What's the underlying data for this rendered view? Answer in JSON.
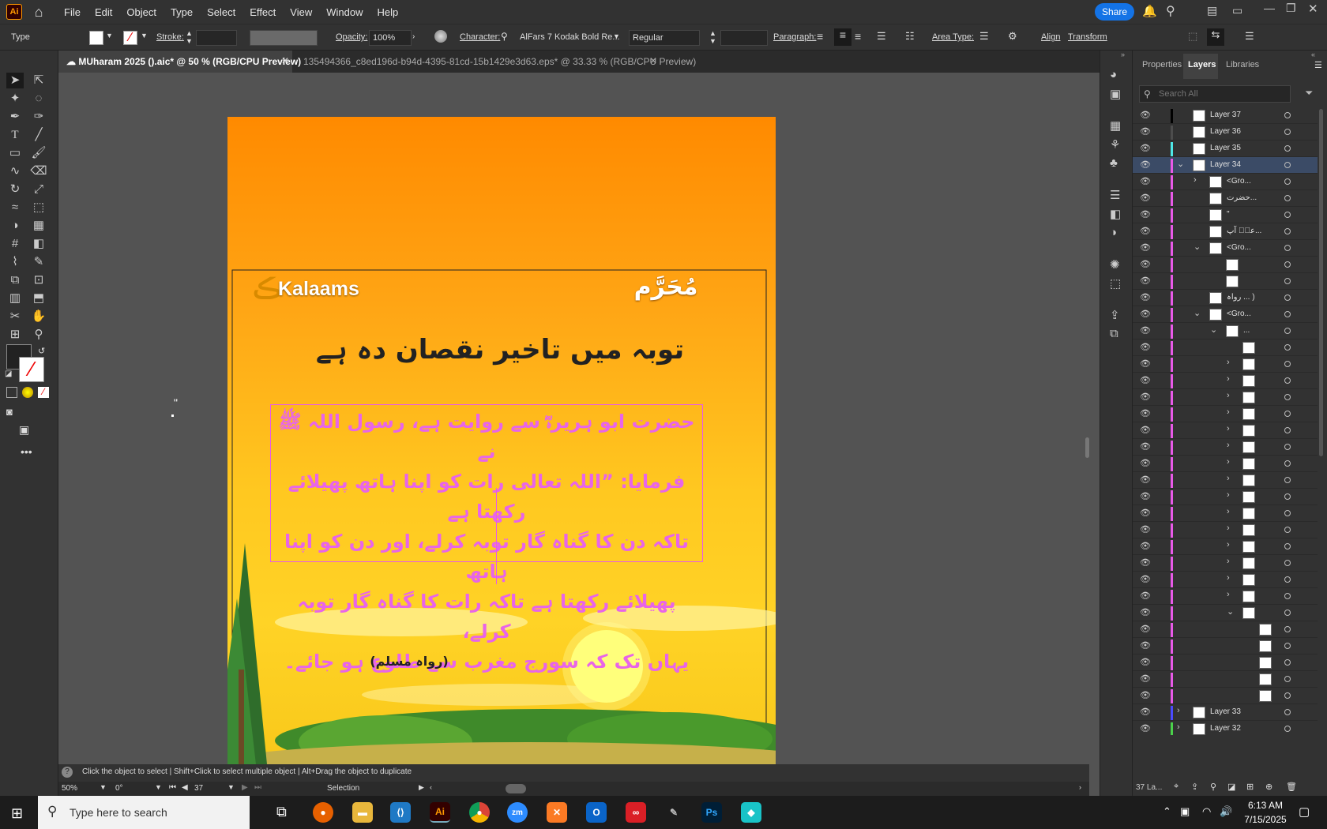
{
  "app": {
    "logo": "Ai",
    "menu": [
      "File",
      "Edit",
      "Object",
      "Type",
      "Select",
      "Effect",
      "View",
      "Window",
      "Help"
    ],
    "share_label": "Share"
  },
  "control": {
    "type_label": "Type",
    "stroke_label": "Stroke:",
    "opacity_label": "Opacity:",
    "opacity_value": "100%",
    "character_label": "Character:",
    "font_name": "AlFars 7 Kodak Bold Re...",
    "font_style": "Regular",
    "paragraph_label": "Paragraph:",
    "area_type_label": "Area Type:",
    "align_label": "Align",
    "transform_label": "Transform"
  },
  "tabs": [
    {
      "title": "MUharam 2025 ().aic* @ 50 % (RGB/CPU Preview)"
    },
    {
      "title": "135494366_c8ed196d-b94d-4395-81cd-15b1429e3d63.eps* @ 33.33 % (RGB/CPU Preview)"
    }
  ],
  "artwork": {
    "brand": "Kalaams",
    "muharram": "مُحَرَّم",
    "title": "توبہ میں تاخیر نقصان دہ ہے",
    "hadith": [
      "حضرت ابو ہریرہؓ سے روایت ہے، رسول اللہ ﷺ نے",
      "فرمایا: ”اللہ تعالی رات کو اپنا ہاتھ پھیلائے رکھتا ہے",
      "تاکہ دن کا گناہ گار توبہ کرلے، اور دن کو اپنا ہاتھ",
      "پھیلائے رکھتا ہے تاکہ رات کا گناہ گار توبہ کرلے،",
      "یہاں تک کہ سورج مغرب سے طلوع ہو جائے۔"
    ],
    "reference": "(رواہ مسلم)",
    "stray_quote": "\""
  },
  "panel": {
    "tabs": [
      "Properties",
      "Layers",
      "Libraries"
    ],
    "search_placeholder": "Search All",
    "footer": "37 La...",
    "layers": [
      {
        "name": "Layer 37",
        "color": "#000000",
        "indent": 0,
        "twisty": ""
      },
      {
        "name": "Layer 36",
        "color": "#4d4d4d",
        "indent": 0,
        "twisty": ""
      },
      {
        "name": "Layer 35",
        "color": "#4ee8e8",
        "indent": 0,
        "twisty": ""
      },
      {
        "name": "Layer 34",
        "color": "#e85ae8",
        "indent": 0,
        "twisty": "v",
        "selected": true
      },
      {
        "name": "<Gro...",
        "color": "#e85ae8",
        "indent": 1,
        "twisty": ">"
      },
      {
        "name": "حضرت...",
        "color": "#e85ae8",
        "indent": 1,
        "twisty": ""
      },
      {
        "name": "\"",
        "color": "#e85ae8",
        "indent": 1,
        "twisty": ""
      },
      {
        "name": "عنؓ آپ...",
        "color": "#e85ae8",
        "indent": 1,
        "twisty": ""
      },
      {
        "name": "<Gro...",
        "color": "#e85ae8",
        "indent": 1,
        "twisty": "v"
      },
      {
        "name": "",
        "color": "#e85ae8",
        "indent": 2,
        "twisty": ""
      },
      {
        "name": "",
        "color": "#e85ae8",
        "indent": 2,
        "twisty": ""
      },
      {
        "name": "رواہ ... )",
        "color": "#e85ae8",
        "indent": 1,
        "twisty": ""
      },
      {
        "name": "<Gro...",
        "color": "#e85ae8",
        "indent": 1,
        "twisty": "v"
      },
      {
        "name": "...",
        "color": "#e85ae8",
        "indent": 2,
        "twisty": "v"
      },
      {
        "name": "",
        "color": "#e85ae8",
        "indent": 3,
        "twisty": ""
      },
      {
        "name": "",
        "color": "#e85ae8",
        "indent": 3,
        "twisty": ">"
      },
      {
        "name": "",
        "color": "#e85ae8",
        "indent": 3,
        "twisty": ">"
      },
      {
        "name": "",
        "color": "#e85ae8",
        "indent": 3,
        "twisty": ">"
      },
      {
        "name": "",
        "color": "#e85ae8",
        "indent": 3,
        "twisty": ">"
      },
      {
        "name": "",
        "color": "#e85ae8",
        "indent": 3,
        "twisty": ">"
      },
      {
        "name": "",
        "color": "#e85ae8",
        "indent": 3,
        "twisty": ">"
      },
      {
        "name": "",
        "color": "#e85ae8",
        "indent": 3,
        "twisty": ">"
      },
      {
        "name": "",
        "color": "#e85ae8",
        "indent": 3,
        "twisty": ">"
      },
      {
        "name": "",
        "color": "#e85ae8",
        "indent": 3,
        "twisty": ">"
      },
      {
        "name": "",
        "color": "#e85ae8",
        "indent": 3,
        "twisty": ">"
      },
      {
        "name": "",
        "color": "#e85ae8",
        "indent": 3,
        "twisty": ">"
      },
      {
        "name": "",
        "color": "#e85ae8",
        "indent": 3,
        "twisty": ">"
      },
      {
        "name": "",
        "color": "#e85ae8",
        "indent": 3,
        "twisty": ">"
      },
      {
        "name": "",
        "color": "#e85ae8",
        "indent": 3,
        "twisty": ">"
      },
      {
        "name": "",
        "color": "#e85ae8",
        "indent": 3,
        "twisty": ">"
      },
      {
        "name": "",
        "color": "#e85ae8",
        "indent": 3,
        "twisty": "v"
      },
      {
        "name": "",
        "color": "#e85ae8",
        "indent": 4,
        "twisty": ""
      },
      {
        "name": "",
        "color": "#e85ae8",
        "indent": 4,
        "twisty": ""
      },
      {
        "name": "",
        "color": "#e85ae8",
        "indent": 4,
        "twisty": ""
      },
      {
        "name": "",
        "color": "#e85ae8",
        "indent": 4,
        "twisty": ""
      },
      {
        "name": "",
        "color": "#e85ae8",
        "indent": 4,
        "twisty": ""
      },
      {
        "name": "Layer 33",
        "color": "#4b4bff",
        "indent": 0,
        "twisty": ">"
      },
      {
        "name": "Layer 32",
        "color": "#4bd14b",
        "indent": 0,
        "twisty": ">"
      }
    ]
  },
  "status": {
    "hint": "Click the object to select  |  Shift+Click to select multiple object  |  Alt+Drag the object to duplicate",
    "zoom": "50%",
    "rotation": "0°",
    "artboard": "37",
    "mode": "Selection"
  },
  "taskbar": {
    "search_placeholder": "Type here to search",
    "time": "6:13 AM",
    "date": "7/15/2025"
  }
}
